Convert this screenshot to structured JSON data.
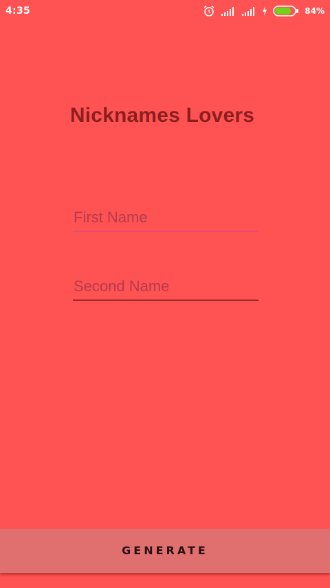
{
  "status_bar": {
    "time": "4:35",
    "battery_percent": "84%",
    "battery_level": 0.84,
    "icons": [
      "alarm-icon",
      "signal-icon",
      "signal-icon",
      "charging-icon",
      "battery-icon"
    ],
    "battery_color": "#76d11a"
  },
  "app": {
    "title": "Nicknames Lovers",
    "background_color": "#ff5252",
    "title_color": "#8b1f1f"
  },
  "form": {
    "first_name": {
      "placeholder": "First Name",
      "value": ""
    },
    "second_name": {
      "placeholder": "Second Name",
      "value": ""
    }
  },
  "generate_button": {
    "label": "GENERATE",
    "color": "#e07070"
  }
}
